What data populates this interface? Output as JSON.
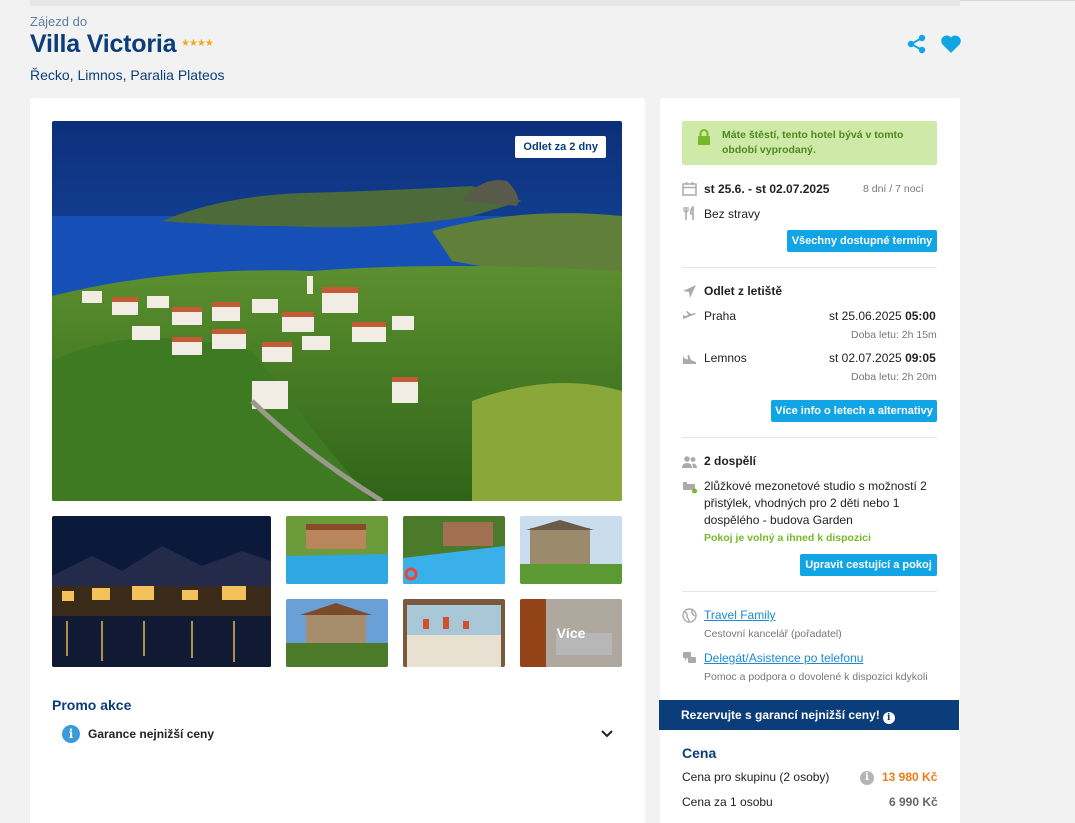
{
  "header": {
    "subtitle": "Zájezd do",
    "title": "Villa Victoria",
    "stars": "★★★★",
    "location": "Řecko, Limnos, Paralia Plateos"
  },
  "gallery": {
    "badge": "Odlet za 2 dny",
    "more_label": "Více"
  },
  "promo": {
    "title": "Promo akce",
    "item": "Garance nejnižší ceny"
  },
  "alert": {
    "text": "Máte štěstí, tento hotel bývá v tomto období vyprodaný."
  },
  "dates": {
    "range": "st 25.6. - st 02.07.2025",
    "length": "8 dní / 7 nocí",
    "board": "Bez stravy",
    "all_dates_button": "Všechny dostupné termíny"
  },
  "flights": {
    "title": "Odlet z letiště",
    "outbound_city": "Praha",
    "outbound_date": "st 25.06.2025",
    "outbound_time": "05:00",
    "outbound_duration": "Doba letu: 2h 15m",
    "return_city": "Lemnos",
    "return_date": "st 02.07.2025",
    "return_time": "09:05",
    "return_duration": "Doba letu: 2h 20m",
    "info_button": "Více info o letech a alternativy"
  },
  "room": {
    "travellers": "2 dospělí",
    "description": "2lůžkové mezonetové studio s možností 2 přistýlek, vhodných pro 2 děti nebo 1 dospělého - budova Garden",
    "availability": "Pokoj je volný a ihned k dispozici",
    "edit_button": "Upravit cestující a pokoj"
  },
  "agency": {
    "name": "Travel Family",
    "role": "Cestovní kancelář (pořadatel)",
    "delegate": "Delegát/Asistence po telefonu",
    "delegate_note": "Pomoc a podpora o dovolené k dispozici kdykoli"
  },
  "guarantee": {
    "text": "Rezervujte s garancí nejnižší ceny!"
  },
  "price": {
    "title": "Cena",
    "group_label": "Cena pro skupinu (2 osoby)",
    "group_value": "13 980 Kč",
    "person_label": "Cena za 1 osobu",
    "person_value": "6 990 Kč"
  },
  "colors": {
    "brand_navy": "#0b3d7a",
    "accent_blue": "#12a5e6",
    "success_green": "#79b829",
    "price_orange": "#f07b14",
    "star_yellow": "#f3a91c"
  }
}
